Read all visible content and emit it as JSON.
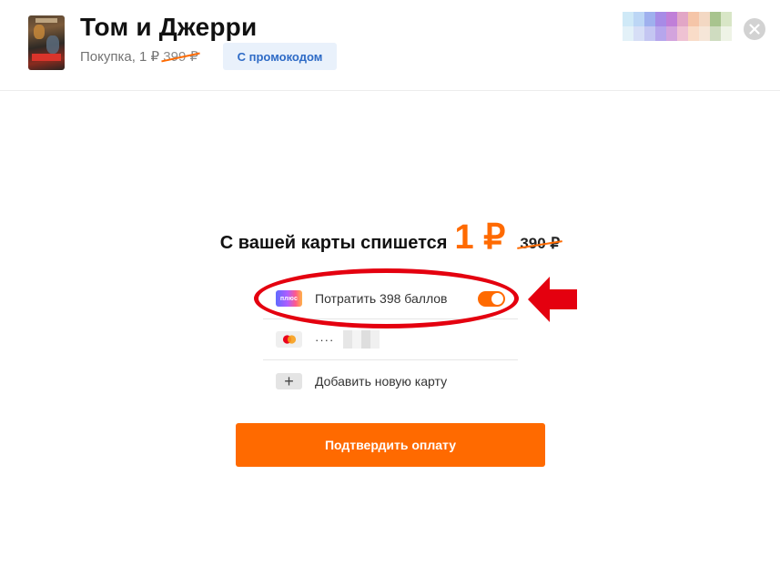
{
  "header": {
    "title": "Том и Джерри",
    "purchase_prefix": "Покупка, 1 ₽",
    "purchase_old_price": "399 ₽",
    "promo_label": "С промокодом",
    "poster_icon": "movie-poster",
    "avatar_pixels": [
      "#cfe9f7",
      "#bcd6f5",
      "#9fb0ee",
      "#a78be6",
      "#c07fd8",
      "#e2a6c6",
      "#f5c5a8",
      "#f3d8c3",
      "#a8c48e",
      "#d8e6c6",
      "#e3f1f8",
      "#d6def6",
      "#c4c6f2",
      "#b6a6ec",
      "#d3a4dd",
      "#efc2d3",
      "#f9dcc8",
      "#f6e6d8",
      "#cfdcc0",
      "#eef3e6"
    ],
    "close_icon": "close-icon"
  },
  "payment": {
    "charge_text": "С вашей карты спишется",
    "charge_price": "1 ₽",
    "charge_old_price": "390 ₽",
    "points_label": "Потратить 398 баллов",
    "points_icon_text": "плюс",
    "points_enabled": true,
    "card_mask": "····",
    "card_pixels": [
      "#e6e6e6",
      "#f4f4f4",
      "#dedede",
      "#f0f0f0"
    ],
    "add_card_label": "Добавить новую карту",
    "add_card_icon": "+",
    "confirm_label": "Подтвердить оплату"
  },
  "colors": {
    "accent": "#ff6a00",
    "promo_bg": "#e9f1fb",
    "promo_text": "#2e6bc6",
    "annotation": "#e4000f"
  }
}
